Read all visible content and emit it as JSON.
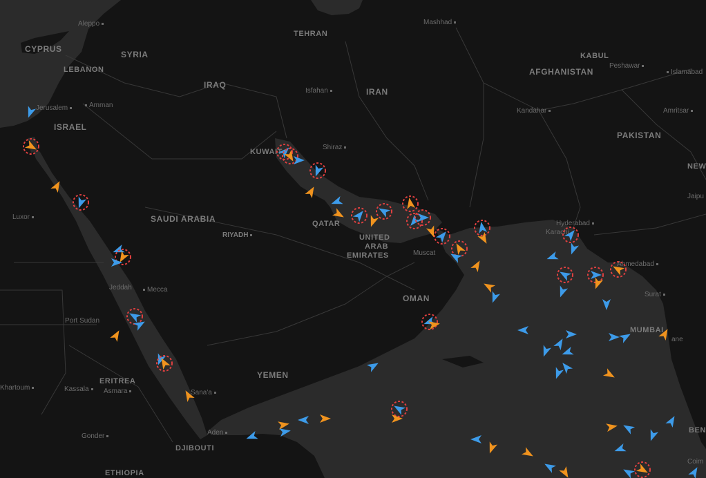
{
  "map": {
    "colors": {
      "land": "#121212",
      "water": "#2b2b2b",
      "border": "#3a3a3a",
      "label": "#7b7b7b",
      "ship_blue": "#3d9be9",
      "ship_orange": "#f0931e",
      "alert_ring": "#e04040"
    }
  },
  "countries": [
    "CYPRUS",
    "SYRIA",
    "LEBANON",
    "IRAQ",
    "ISRAEL",
    "TEHRAN",
    "IRAN",
    "AFGHANISTAN",
    "KABUL",
    "PAKISTAN",
    "KUWAIT",
    "QATAR",
    "UNITED",
    "ARAB",
    "EMIRATES",
    "SAUDI ARABIA",
    "OMAN",
    "YEMEN",
    "ERITREA",
    "DJIBOUTI",
    "ETHIOPIA",
    "MUMBAI",
    "NEW",
    "RIYADH",
    "BEN"
  ],
  "cities": [
    "Aleppo",
    "Mashhad",
    "Amman",
    "Jerusalem",
    "Isfahan",
    "Peshawar",
    "Islamabad",
    "Shiraz",
    "Kandahar",
    "Amritsar",
    "Luxor",
    "Jaipu",
    "Hyderabad",
    "Karachi",
    "Muscat",
    "Ahmedabad",
    "Jeddah",
    "Mecca",
    "Surat",
    "Port Sudan",
    "Khartoum",
    "Kassala",
    "Asmara",
    "Sana'a",
    "Aden",
    "Gonder",
    "Coim",
    "ane"
  ],
  "ships": [
    {
      "c": "blue",
      "dir": 200
    },
    {
      "c": "orange",
      "dir": 120
    },
    {
      "c": "blue",
      "dir": 40
    },
    {
      "c": "orange",
      "dir": 150
    },
    {
      "c": "blue",
      "dir": 60
    },
    {
      "c": "orange",
      "dir": 300
    },
    {
      "c": "blue",
      "dir": 250
    },
    {
      "c": "blue",
      "dir": 190
    },
    {
      "c": "orange",
      "dir": 210
    },
    {
      "c": "blue",
      "dir": 45
    },
    {
      "c": "orange",
      "dir": 330
    },
    {
      "c": "blue",
      "dir": 90
    },
    {
      "c": "blue",
      "dir": 300
    },
    {
      "c": "orange",
      "dir": 30
    },
    {
      "c": "blue",
      "dir": 130
    },
    {
      "c": "orange",
      "dir": 80
    },
    {
      "c": "blue",
      "dir": 15
    },
    {
      "c": "blue",
      "dir": 270
    },
    {
      "c": "orange",
      "dir": 200
    },
    {
      "c": "blue",
      "dir": 160
    }
  ]
}
